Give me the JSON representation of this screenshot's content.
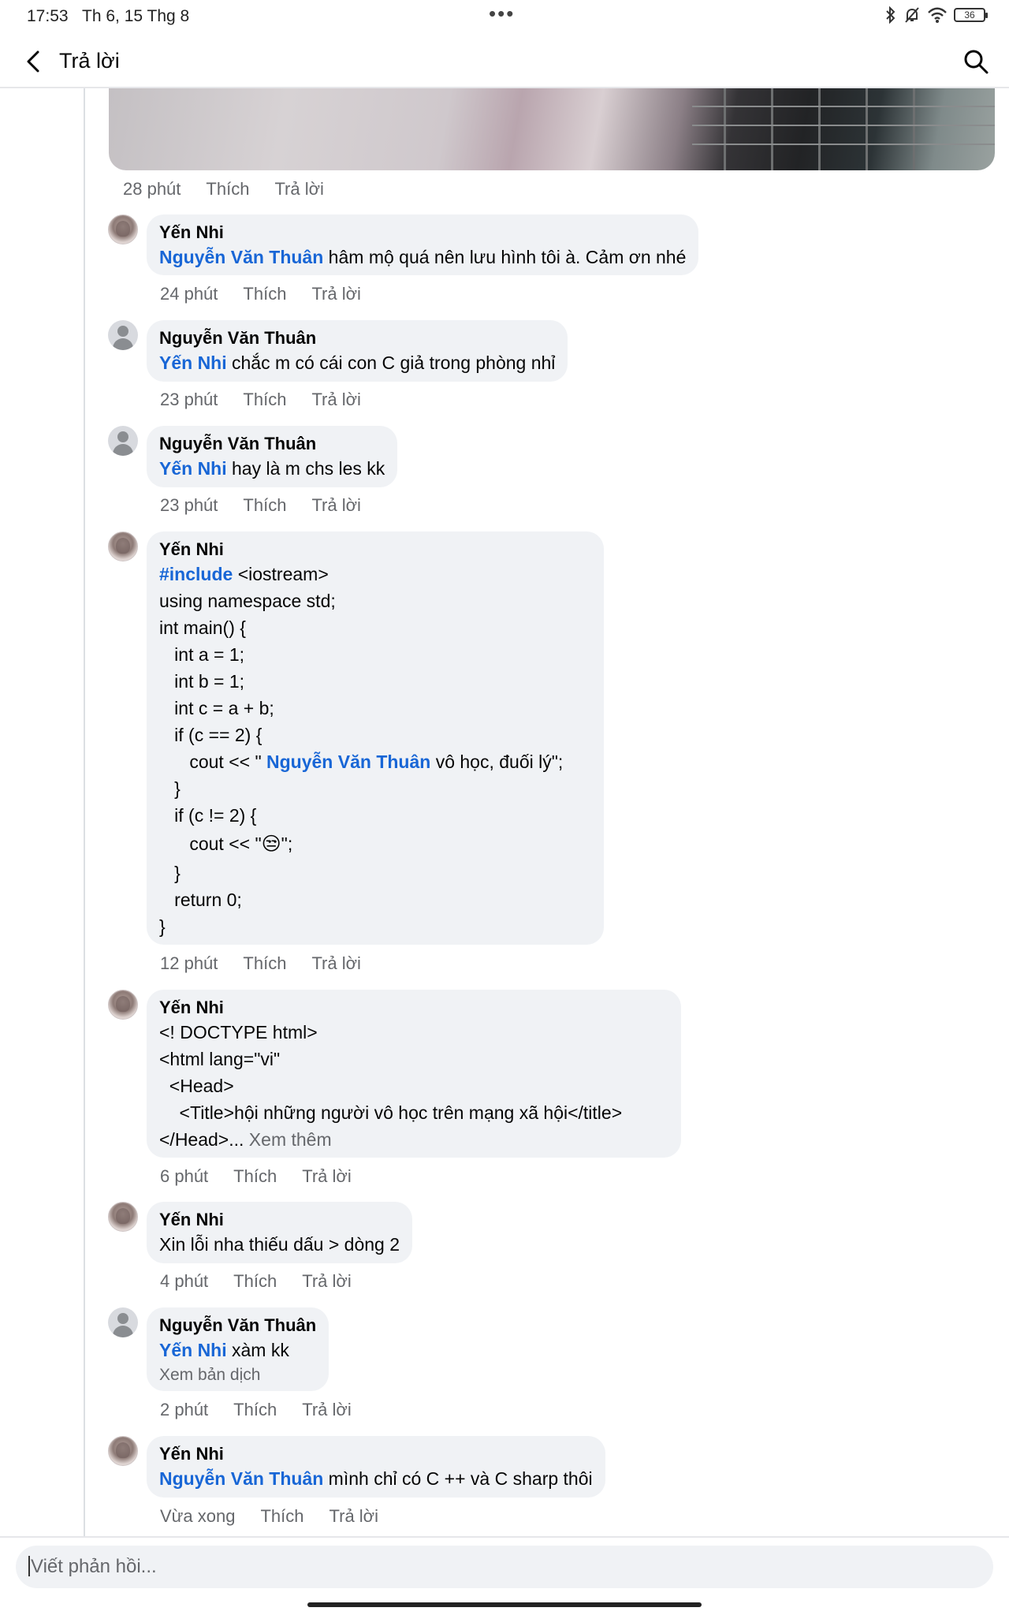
{
  "status_bar": {
    "time": "17:53",
    "date": "Th 6, 15 Thg 8",
    "dots": "•••",
    "battery": "36"
  },
  "header": {
    "title": "Trả lời"
  },
  "attachment_meta": {
    "time": "28 phút",
    "like": "Thích",
    "reply": "Trả lời"
  },
  "comments": [
    {
      "author": "Yến Nhi",
      "mention": "Nguyễn Văn Thuân",
      "text": " hâm mộ quá nên lưu hình tôi à. Cảm ơn nhé",
      "time": "24 phút",
      "like": "Thích",
      "reply": "Trả lời"
    },
    {
      "author": "Nguyễn Văn Thuân",
      "mention": "Yến Nhi",
      "text": " chắc m có cái con C giả trong phòng nhỉ",
      "time": "23 phút",
      "like": "Thích",
      "reply": "Trả lời"
    },
    {
      "author": "Nguyễn Văn Thuân",
      "mention": "Yến Nhi",
      "text": " hay là m chs les kk",
      "time": "23 phút",
      "like": "Thích",
      "reply": "Trả lời"
    },
    {
      "author": "Yến Nhi",
      "code": {
        "include_kw": "#include",
        "include_rest": " <iostream>",
        "l2": "using namespace std;",
        "l3": "int main() {",
        "l4": "   int a = 1;",
        "l5": "   int b = 1;",
        "l6": "   int c = a + b;",
        "l7": "   if (c == 2) {",
        "l8_pre": "      cout << \" ",
        "l8_mention": "Nguyễn Văn Thuân",
        "l8_post": " vô học, đuối lý\";",
        "l9": "   }",
        "l10": "   if (c != 2) {",
        "l11_pre": "      cout << \"",
        "l11_emoji": "😒",
        "l11_post": "\";",
        "l12": "   }",
        "l13": "   return 0;",
        "l14": "}"
      },
      "time": "12 phút",
      "like": "Thích",
      "reply": "Trả lời"
    },
    {
      "author": "Yến Nhi",
      "lines": [
        "<! DOCTYPE html>",
        "<html lang=\"vi\"",
        "  <Head>",
        "    <Title>hội những người vô học trên mạng xã hội</title>"
      ],
      "last_line": "</Head>...",
      "see_more": " Xem thêm",
      "time": "6 phút",
      "like": "Thích",
      "reply": "Trả lời"
    },
    {
      "author": "Yến Nhi",
      "text": "Xin lỗi nha thiếu dấu > dòng 2",
      "time": "4 phút",
      "like": "Thích",
      "reply": "Trả lời"
    },
    {
      "author": "Nguyễn Văn Thuân",
      "mention": "Yến Nhi",
      "text": " xàm kk",
      "translate": "Xem bản dịch",
      "time": "2 phút",
      "like": "Thích",
      "reply": "Trả lời"
    },
    {
      "author": "Yến Nhi",
      "mention": "Nguyễn Văn Thuân",
      "text": " mình chỉ có C ++ và C sharp thôi",
      "time": "Vừa xong",
      "like": "Thích",
      "reply": "Trả lời"
    }
  ],
  "composer": {
    "placeholder": "Viết phản hồi..."
  }
}
